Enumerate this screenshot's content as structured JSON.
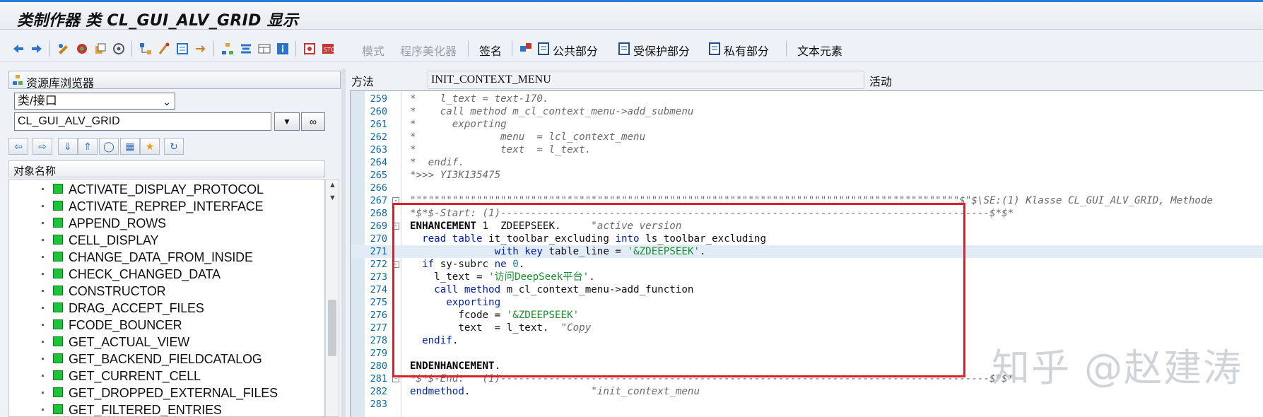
{
  "window": {
    "title": "类制作器 类 CL_GUI_ALV_GRID 显示"
  },
  "toolbar": {
    "items": [
      {
        "type": "icon",
        "name": "back-arrow-icon"
      },
      {
        "type": "icon",
        "name": "forward-arrow-icon"
      },
      {
        "type": "icon",
        "name": "display-change-icon"
      },
      {
        "type": "icon",
        "name": "activate-icon"
      },
      {
        "type": "icon",
        "name": "other-object-icon"
      },
      {
        "type": "icon",
        "name": "where-used-icon"
      },
      {
        "type": "icon",
        "name": "hierarchy-icon"
      },
      {
        "type": "icon",
        "name": "test-icon"
      },
      {
        "type": "icon",
        "name": "object-list-icon"
      },
      {
        "type": "icon",
        "name": "navigate-icon"
      },
      {
        "type": "icon",
        "name": "tree-icon"
      },
      {
        "type": "icon",
        "name": "stack-icon"
      },
      {
        "type": "icon",
        "name": "layout-icon"
      },
      {
        "type": "icon",
        "name": "info-icon"
      },
      {
        "type": "icon",
        "name": "enhance-icon"
      },
      {
        "type": "icon",
        "name": "breakpoint-icon"
      }
    ],
    "pattern_label": "模式",
    "pretty_printer_label": "程序美化器",
    "signature_label": "签名",
    "public_section_label": "公共部分",
    "protected_section_label": "受保护部分",
    "private_section_label": "私有部分",
    "text_elements_label": "文本元素"
  },
  "repository_browser": {
    "title": "资源库浏览器",
    "object_type": "类/接口",
    "object_name": "CL_GUI_ALV_GRID",
    "tree_header": "对象名称",
    "methods": [
      "ACTIVATE_DISPLAY_PROTOCOL",
      "ACTIVATE_REPREP_INTERFACE",
      "APPEND_ROWS",
      "CELL_DISPLAY",
      "CHANGE_DATA_FROM_INSIDE",
      "CHECK_CHANGED_DATA",
      "CONSTRUCTOR",
      "DRAG_ACCEPT_FILES",
      "FCODE_BOUNCER",
      "GET_ACTUAL_VIEW",
      "GET_BACKEND_FIELDCATALOG",
      "GET_CURRENT_CELL",
      "GET_DROPPED_EXTERNAL_FILES",
      "GET_FILTERED_ENTRIES"
    ]
  },
  "editor": {
    "method_label": "方法",
    "method_name": "INIT_CONTEXT_MENU",
    "status": "活动",
    "lines": [
      {
        "n": "259",
        "fold": "",
        "hl": false,
        "segs": [
          [
            "cm",
            "*    l_text = text-170."
          ]
        ]
      },
      {
        "n": "260",
        "fold": "",
        "hl": false,
        "segs": [
          [
            "cm",
            "*    call method m_cl_context_menu->add_submenu"
          ]
        ]
      },
      {
        "n": "261",
        "fold": "",
        "hl": false,
        "segs": [
          [
            "cm",
            "*      exporting"
          ]
        ]
      },
      {
        "n": "262",
        "fold": "",
        "hl": false,
        "segs": [
          [
            "cm",
            "*              menu  = lcl_context_menu"
          ]
        ]
      },
      {
        "n": "263",
        "fold": "",
        "hl": false,
        "segs": [
          [
            "cm",
            "*              text  = l_text."
          ]
        ]
      },
      {
        "n": "264",
        "fold": "",
        "hl": false,
        "segs": [
          [
            "cm",
            "*  endif."
          ]
        ]
      },
      {
        "n": "265",
        "fold": "",
        "hl": false,
        "segs": [
          [
            "cm",
            "*>>> YI3K135475"
          ]
        ]
      },
      {
        "n": "266",
        "fold": "",
        "hl": false,
        "segs": []
      },
      {
        "n": "267",
        "fold": "-",
        "hl": false,
        "segs": [
          [
            "cm",
            "\"\"\"\"\"\"\"\"\"\"\"\"\"\"\"\"\"\"\"\"\"\"\"\"\"\"\"\"\"\"\"\"\"\"\"\"\"\"\"\"\"\"\"\"\"\"\"\"\"\"\"\"\"\"\"\"\"\"\"\"\"\"\"\"\"\"\"\"\"\"\"\"\"\"\"\"\"\"\"\"\"\"\"\"\"\"\"\"\"\"\"$\"$\\SE:(1) Klasse CL_GUI_ALV_GRID, Methode"
          ]
        ]
      },
      {
        "n": "268",
        "fold": "",
        "hl": false,
        "segs": [
          [
            "cm",
            "*$*$-Start: (1)---------------------------------------------------------------------------------$*$*"
          ]
        ]
      },
      {
        "n": "269",
        "fold": "-",
        "hl": false,
        "segs": [
          [
            "kb",
            "ENHANCEMENT"
          ],
          [
            "plain",
            " 1  ZDEEPSEEK.     "
          ],
          [
            "cm",
            "\"active version"
          ]
        ]
      },
      {
        "n": "270",
        "fold": "",
        "hl": false,
        "segs": [
          [
            "plain",
            "  "
          ],
          [
            "kw",
            "read table"
          ],
          [
            "plain",
            " it_toolbar_excluding "
          ],
          [
            "kw",
            "into"
          ],
          [
            "plain",
            " ls_toolbar_excluding"
          ]
        ]
      },
      {
        "n": "271",
        "fold": "",
        "hl": true,
        "segs": [
          [
            "plain",
            "              "
          ],
          [
            "kw",
            "with key"
          ],
          [
            "plain",
            " table_line = "
          ],
          [
            "str",
            "'&ZDEEPSEEK'"
          ],
          [
            "plain",
            "."
          ]
        ]
      },
      {
        "n": "272",
        "fold": "-",
        "hl": false,
        "segs": [
          [
            "plain",
            "  "
          ],
          [
            "kw",
            "if"
          ],
          [
            "plain",
            " sy-subrc "
          ],
          [
            "kw",
            "ne"
          ],
          [
            "plain",
            " "
          ],
          [
            "num",
            "0"
          ],
          [
            "plain",
            "."
          ]
        ]
      },
      {
        "n": "273",
        "fold": "",
        "hl": false,
        "segs": [
          [
            "plain",
            "    l_text = "
          ],
          [
            "str",
            "'访问DeepSeek平台'"
          ],
          [
            "plain",
            "."
          ]
        ]
      },
      {
        "n": "274",
        "fold": "",
        "hl": false,
        "segs": [
          [
            "plain",
            "    "
          ],
          [
            "kw",
            "call method"
          ],
          [
            "plain",
            " m_cl_context_menu->add_function"
          ]
        ]
      },
      {
        "n": "275",
        "fold": "",
        "hl": false,
        "segs": [
          [
            "plain",
            "      "
          ],
          [
            "kw",
            "exporting"
          ]
        ]
      },
      {
        "n": "276",
        "fold": "",
        "hl": false,
        "segs": [
          [
            "plain",
            "        fcode = "
          ],
          [
            "str",
            "'&ZDEEPSEEK'"
          ]
        ]
      },
      {
        "n": "277",
        "fold": "",
        "hl": false,
        "segs": [
          [
            "plain",
            "        text  = l_text.  "
          ],
          [
            "cm",
            "\"Copy"
          ]
        ]
      },
      {
        "n": "278",
        "fold": "",
        "hl": false,
        "segs": [
          [
            "plain",
            "  "
          ],
          [
            "kw",
            "endif"
          ],
          [
            "plain",
            "."
          ]
        ]
      },
      {
        "n": "279",
        "fold": "",
        "hl": false,
        "segs": []
      },
      {
        "n": "280",
        "fold": "",
        "hl": false,
        "segs": [
          [
            "kb",
            "ENDENHANCEMENT"
          ],
          [
            "plain",
            "."
          ]
        ]
      },
      {
        "n": "281",
        "fold": "-",
        "hl": false,
        "segs": [
          [
            "cm",
            "*$*$-End:   (1)---------------------------------------------------------------------------------$*$*"
          ]
        ]
      },
      {
        "n": "282",
        "fold": "",
        "hl": false,
        "segs": [
          [
            "kw",
            "endmethod"
          ],
          [
            "plain",
            ".                    "
          ],
          [
            "cm",
            "\"init_context_menu"
          ]
        ]
      },
      {
        "n": "283",
        "fold": "",
        "hl": false,
        "segs": []
      }
    ]
  },
  "watermark": "知乎 @赵建涛",
  "colors": {
    "accent": "#2c7bd6",
    "highlight_box": "#d9232a",
    "status_green": "#1cc43a"
  }
}
